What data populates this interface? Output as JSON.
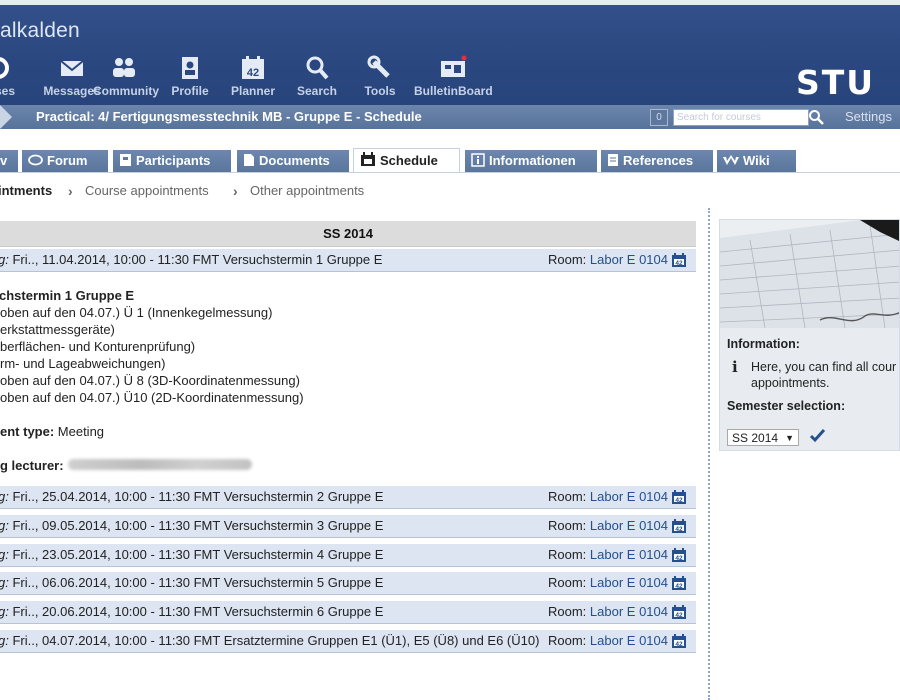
{
  "header": {
    "site_title": "alkalden",
    "logo": "STU",
    "nav": [
      {
        "label": "ses",
        "icon": "courses-icon"
      },
      {
        "label": "Messages",
        "icon": "messages-icon"
      },
      {
        "label": "Community",
        "icon": "community-icon"
      },
      {
        "label": "Profile",
        "icon": "profile-icon"
      },
      {
        "label": "Planner",
        "icon": "planner-icon"
      },
      {
        "label": "Search",
        "icon": "search-icon"
      },
      {
        "label": "Tools",
        "icon": "tools-icon"
      },
      {
        "label": "BulletinBoard",
        "icon": "bulletinboard-icon"
      }
    ]
  },
  "breadcrumb": {
    "text": "Practical: 4/ Fertigungsmesstechnik MB - Gruppe E - Schedule",
    "count": "0",
    "search_placeholder": "Search for courses",
    "settings": "Settings"
  },
  "tabs": [
    {
      "label": "v",
      "icon": ""
    },
    {
      "label": "Forum",
      "icon": "forum-icon"
    },
    {
      "label": "Participants",
      "icon": "participants-icon"
    },
    {
      "label": "Documents",
      "icon": "documents-icon"
    },
    {
      "label": "Schedule",
      "icon": "schedule-icon",
      "active": true
    },
    {
      "label": "Informationen",
      "icon": "info-icon"
    },
    {
      "label": "References",
      "icon": "references-icon"
    },
    {
      "label": "Wiki",
      "icon": "wiki-icon"
    }
  ],
  "subnav": {
    "active": "intments",
    "links": [
      "Course appointments",
      "Other appointments"
    ]
  },
  "schedule": {
    "semester": "SS 2014",
    "room_label": "Room:",
    "appointments": [
      {
        "prefix": "g:",
        "text": " Fri.., 11.04.2014, 10:00 - 11:30 FMT Versuchstermin 1 Gruppe E",
        "room": "Labor E 0104"
      },
      {
        "prefix": "g:",
        "text": " Fri.., 25.04.2014, 10:00 - 11:30 FMT Versuchstermin 2 Gruppe E",
        "room": "Labor E 0104"
      },
      {
        "prefix": "g:",
        "text": " Fri.., 09.05.2014, 10:00 - 11:30 FMT Versuchstermin 3 Gruppe E",
        "room": "Labor E 0104"
      },
      {
        "prefix": "g:",
        "text": " Fri.., 23.05.2014, 10:00 - 11:30 FMT Versuchstermin 4 Gruppe E",
        "room": "Labor E 0104"
      },
      {
        "prefix": "g:",
        "text": " Fri.., 06.06.2014, 10:00 - 11:30 FMT Versuchstermin 5 Gruppe E",
        "room": "Labor E 0104"
      },
      {
        "prefix": "g:",
        "text": " Fri.., 20.06.2014, 10:00 - 11:30 FMT Versuchstermin 6 Gruppe E",
        "room": "Labor E 0104"
      },
      {
        "prefix": "g:",
        "text": " Fri.., 04.07.2014, 10:00 - 11:30 FMT Ersatztermine Gruppen E1 (Ü1), E5 (Ü8) und E6 (Ü10)",
        "room": "Labor E 0104"
      }
    ],
    "detail": {
      "title": "chstermin 1 Gruppe E",
      "lines": [
        "oben auf den 04.07.) Ü 1 (Innenkegelmessung)",
        "erkstattmessgeräte)",
        "berflächen- und Konturenprüfung)",
        "rm- und Lageabweichungen)",
        "oben auf den 04.07.) Ü 8 (3D-Koordinatenmessung)",
        "oben auf den 04.07.) Ü10 (2D-Koordinatenmessung)"
      ],
      "type_label": "ent type:",
      "type_value": " Meeting",
      "lecturer_label": "g lecturer:"
    }
  },
  "sidebar": {
    "information_heading": "Information:",
    "info_line1": "Here, you can find all cour",
    "info_line2": "appointments.",
    "semester_heading": "Semester selection:",
    "semester_value": "SS 2014"
  },
  "colors": {
    "header_bg": "#2b4780",
    "tab_bg": "#5f7aa1",
    "row_bg": "#dce5f1",
    "link": "#24508e"
  }
}
